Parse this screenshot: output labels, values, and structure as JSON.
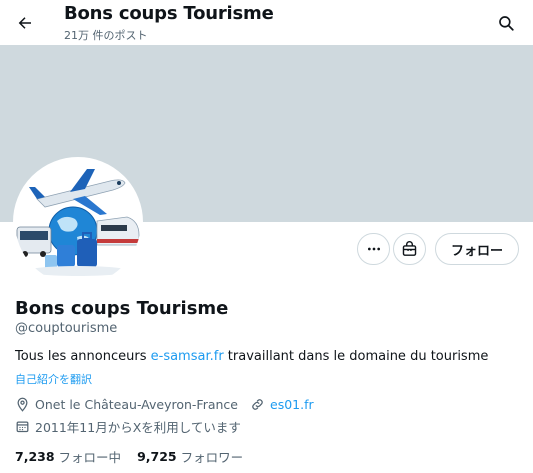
{
  "header": {
    "title": "Bons coups Tourisme",
    "post_count": "21万 件のポスト",
    "back_icon": "arrow-left-icon",
    "search_icon": "search-icon"
  },
  "profile": {
    "name": "Bons coups Tourisme",
    "handle": "@couptourisme",
    "bio_before": "Tous les annonceurs ",
    "bio_link": "e-samsar.fr",
    "bio_after": " travaillant dans le domaine du tourisme",
    "translate_label": "自己紹介を翻訳",
    "location": "Onet le Château-Aveyron-France",
    "website": "es01.fr",
    "joined": "2011年11月からXを利用しています",
    "follow_button": "フォロー"
  },
  "stats": {
    "following_count": "7,238",
    "following_label": "フォロー中",
    "followers_count": "9,725",
    "followers_label": "フォロワー"
  },
  "colors": {
    "banner": "#cfd9de",
    "accent": "#1d9bf0",
    "secondary_text": "#536471"
  }
}
